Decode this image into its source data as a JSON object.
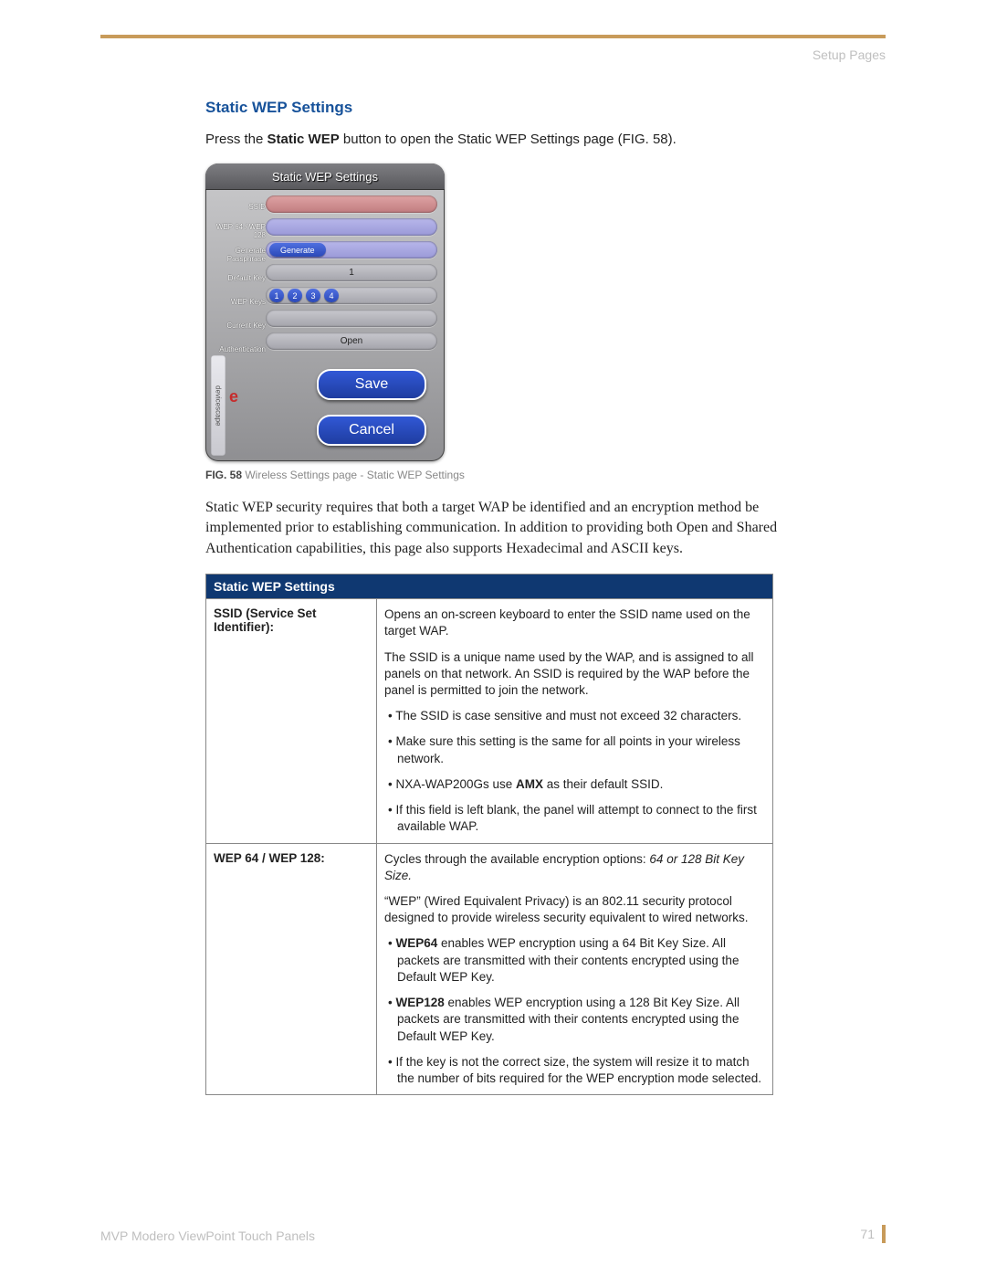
{
  "header": {
    "right_text": "Setup Pages"
  },
  "section": {
    "heading": "Static WEP Settings",
    "intro_pre": "Press the ",
    "intro_bold": "Static WEP",
    "intro_post": " button to open the Static WEP Settings page (FIG. 58)."
  },
  "widget": {
    "title": "Static WEP Settings",
    "labels": {
      "ssid": "SSID",
      "wep": "WEP 64 / WEP 128",
      "generate": "Generate Passphrase",
      "default_key": "Default Key",
      "wep_keys": "WEP Keys",
      "current_key": "Current Key",
      "auth": "Authentication"
    },
    "generate_btn": "Generate",
    "default_key_value": "1",
    "keys": [
      "1",
      "2",
      "3",
      "4"
    ],
    "auth_value": "Open",
    "side_text": "devicescape",
    "save_btn": "Save",
    "cancel_btn": "Cancel"
  },
  "caption": {
    "label": "FIG. 58",
    "text": "  Wireless Settings page - Static WEP Settings"
  },
  "paragraph": "Static WEP security requires that both a target WAP be identified and an encryption method be implemented prior to establishing communication. In addition to providing both Open and Shared Authentication capabilities, this page also supports Hexadecimal and ASCII keys.",
  "table": {
    "header": "Static WEP Settings",
    "rows": [
      {
        "term": "SSID (Service Set Identifier):",
        "desc": {
          "p1": "Opens an on-screen keyboard to enter the SSID name used on the target WAP.",
          "p2": "The SSID is a unique name used by the WAP, and is assigned to all panels on that network. An SSID is required by the WAP before the panel is permitted to join the network.",
          "b1": "The SSID is case sensitive and must not exceed 32 characters.",
          "b2": "Make sure this setting is the same for all points in your wireless network.",
          "b3_pre": "NXA-WAP200Gs use ",
          "b3_bold": "AMX",
          "b3_post": " as their default SSID.",
          "b4": "If this field is left blank, the panel will attempt to connect to the first available WAP."
        }
      },
      {
        "term": "WEP 64 / WEP 128:",
        "desc": {
          "p1_pre": "Cycles through the available encryption options: ",
          "p1_italic": "64 or 128 Bit Key Size.",
          "p2": "“WEP” (Wired Equivalent Privacy) is an 802.11 security protocol designed to provide wireless security equivalent to wired networks.",
          "b1_bold": "WEP64",
          "b1_post": " enables WEP encryption using a 64 Bit Key Size. All packets are transmitted with their contents encrypted using the Default WEP Key.",
          "b2_bold": "WEP128",
          "b2_post": " enables WEP encryption using a 128 Bit Key Size. All packets are transmitted with their contents encrypted using the Default WEP Key.",
          "b3": "If the key is not the correct size, the system will resize it to match the number of bits required for the WEP encryption mode selected."
        }
      }
    ]
  },
  "footer": {
    "left": "MVP Modero ViewPoint Touch Panels",
    "page": "71"
  }
}
